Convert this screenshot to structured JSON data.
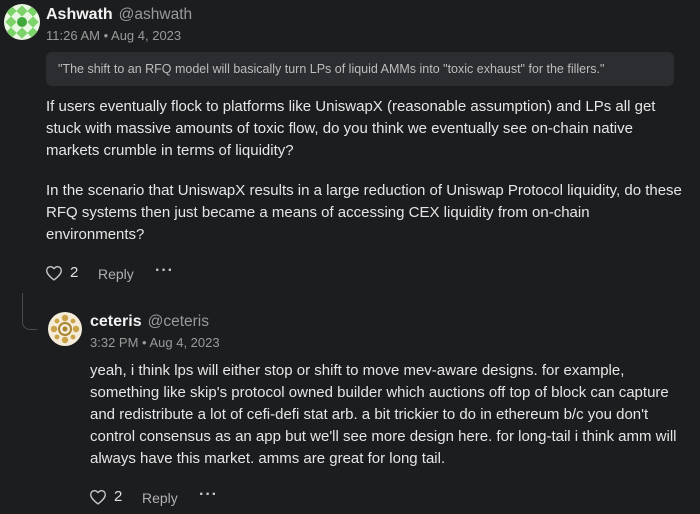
{
  "post": {
    "author_name": "Ashwath",
    "author_handle": "@ashwath",
    "timestamp": "11:26 AM • Aug 4, 2023",
    "quote": "\"The shift to an RFQ model will basically turn LPs of liquid AMMs into \"toxic exhaust\" for the fillers.\"",
    "paragraphs": [
      "If users eventually flock to platforms like UniswapX (reasonable assumption) and LPs all get stuck with massive amounts of toxic flow, do you think we eventually see on-chain native markets crumble in terms of liquidity?",
      "In the scenario that UniswapX results in a large reduction of Uniswap Protocol liquidity, do these RFQ systems then just became a means of accessing CEX liquidity from on-chain environments?"
    ],
    "like_count": "2",
    "reply_label": "Reply",
    "more_label": "···"
  },
  "reply": {
    "author_name": "ceteris",
    "author_handle": "@ceteris",
    "timestamp": "3:32 PM • Aug 4, 2023",
    "text": "yeah, i think lps will either stop or shift to move mev-aware designs. for example, something like skip's protocol owned builder which auctions off top of block can capture and redistribute a lot of cefi-defi stat arb. a bit trickier to do in ethereum b/c you don't control consensus as an app but we'll see more design here. for long-tail i think amm will always have this market. amms are great for long tail.",
    "like_count": "2",
    "reply_label": "Reply",
    "more_label": "···"
  },
  "icons": {
    "heart": "heart-outline-icon",
    "avatar_ashwath": "green-pattern-avatar",
    "avatar_ceteris": "gold-pattern-avatar"
  },
  "colors": {
    "background": "#1c1d1f",
    "quote_background": "#2c2d30",
    "avatar_green": "#7bd36a",
    "avatar_gold": "#c9a24a"
  }
}
